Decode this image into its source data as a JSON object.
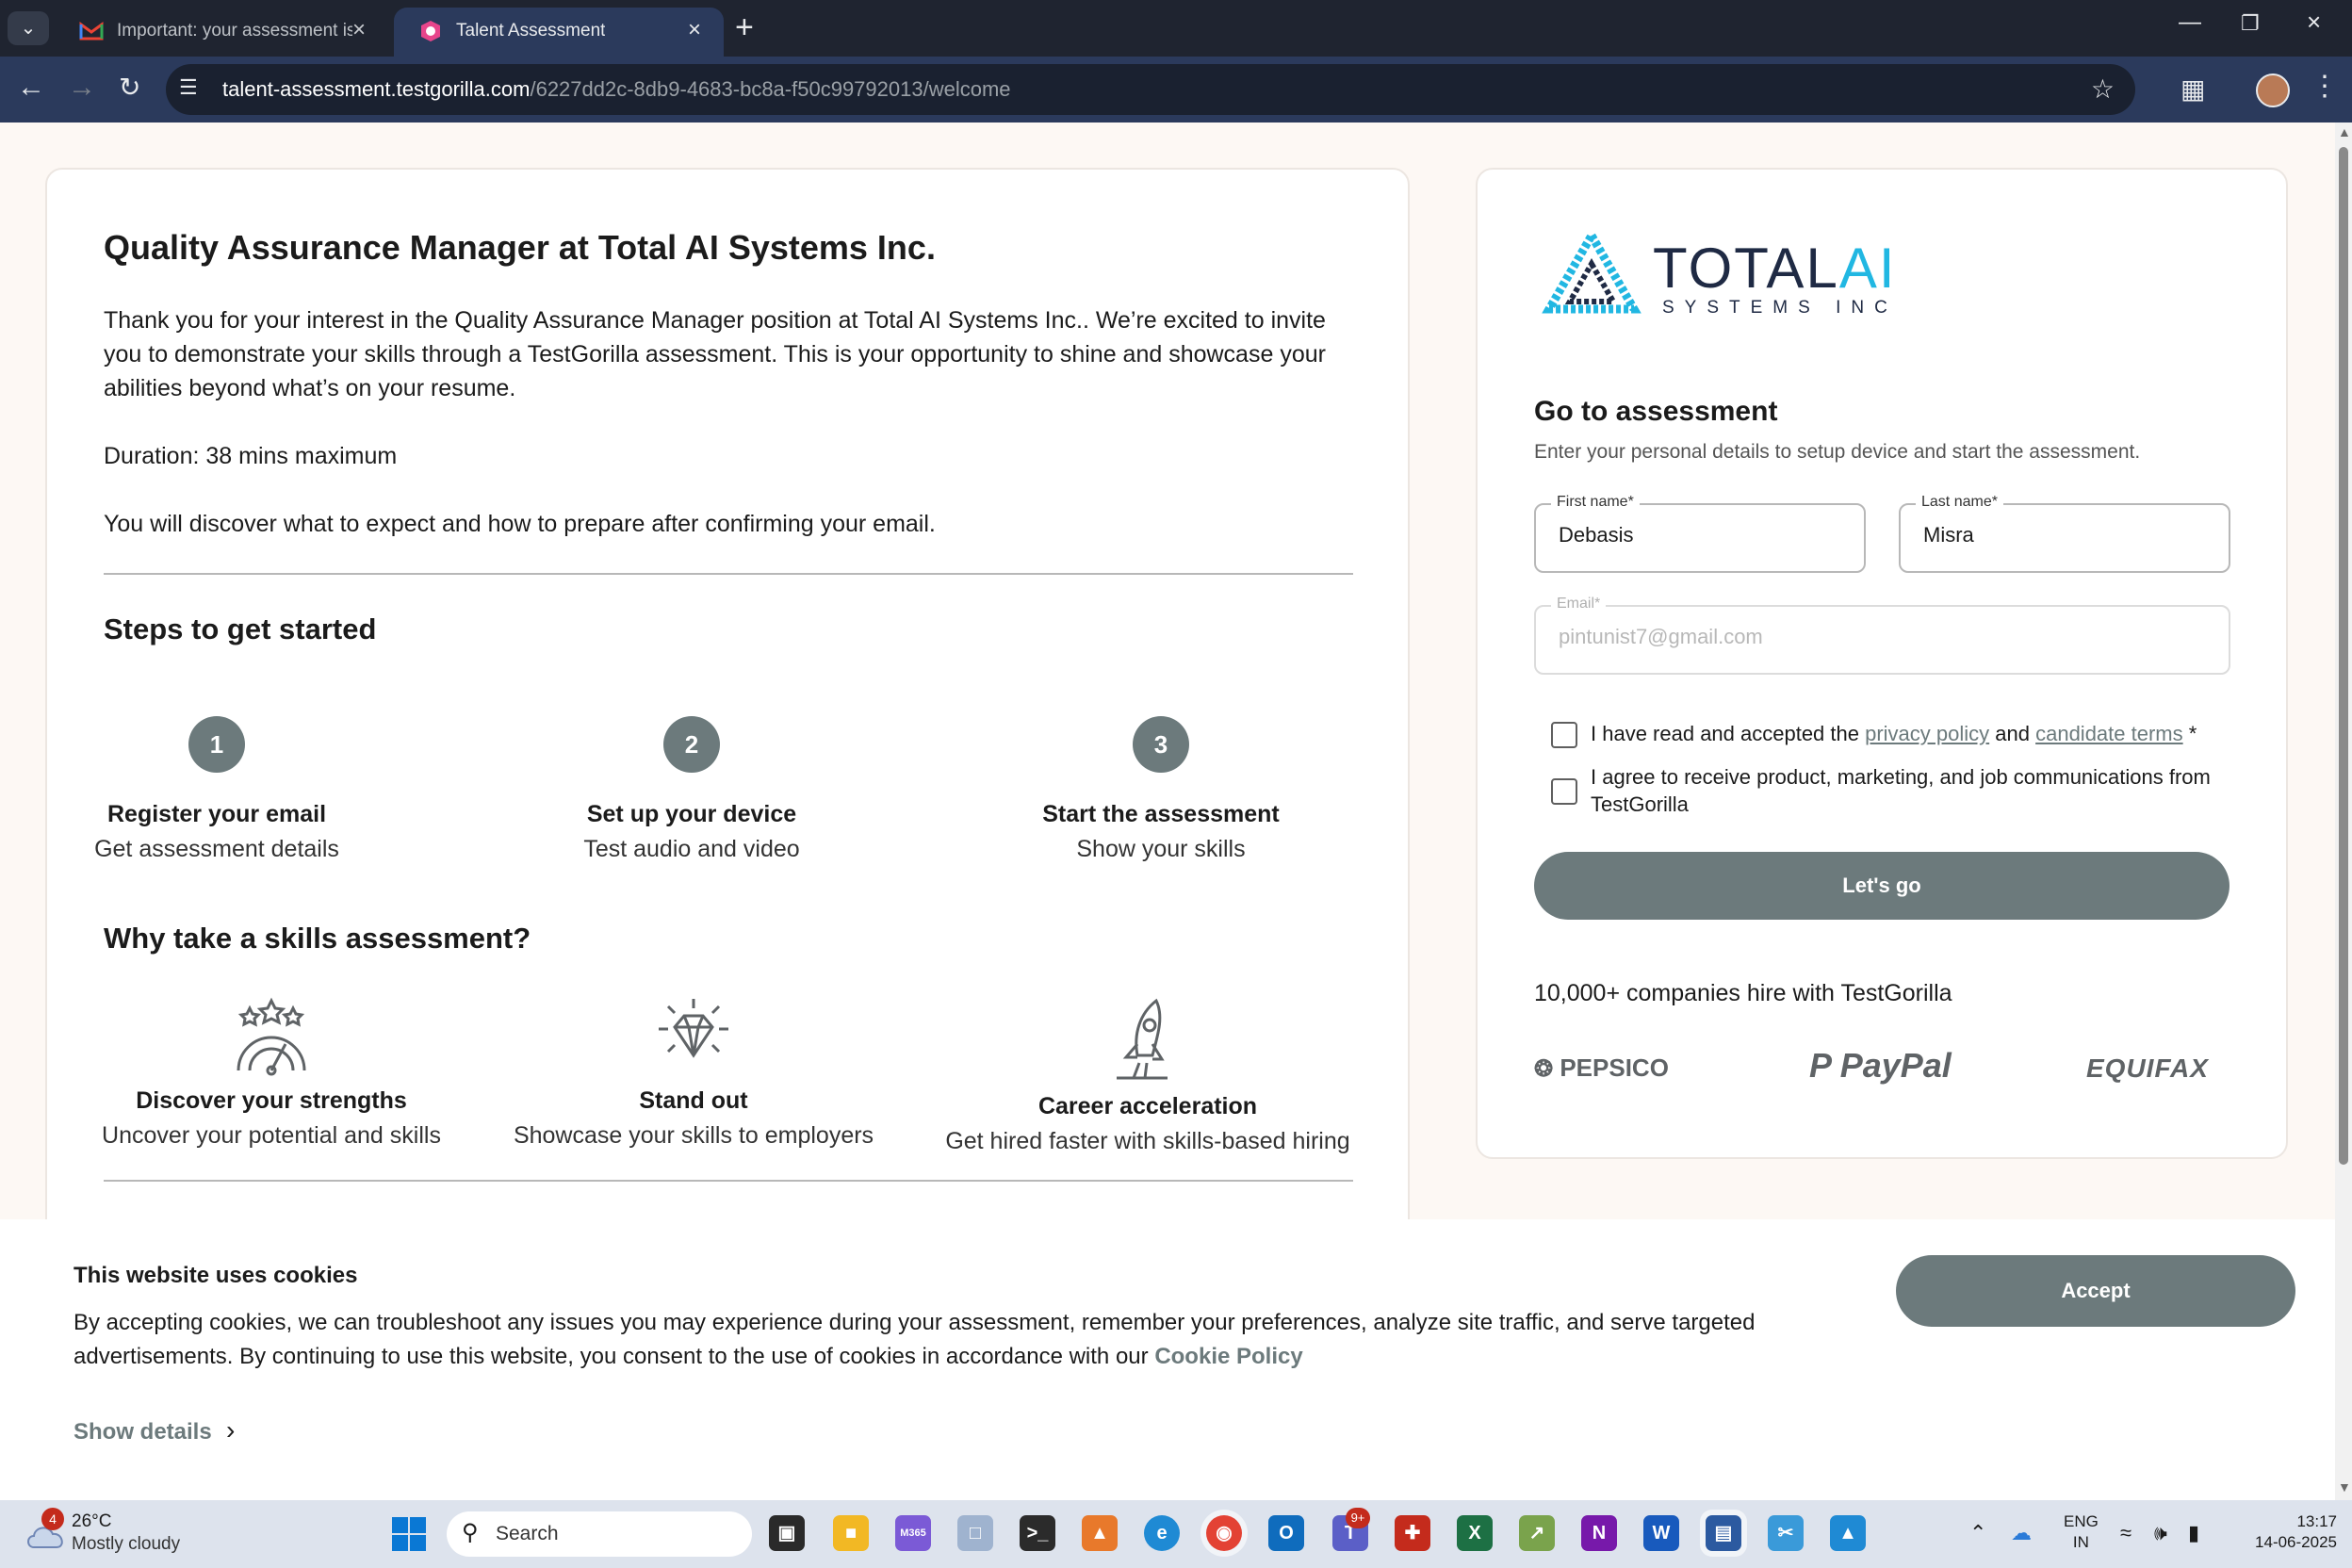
{
  "browser": {
    "tabs": [
      {
        "title": "Important: your assessment is w",
        "icon": "gmail-icon",
        "active": false
      },
      {
        "title": "Talent Assessment",
        "icon": "testgorilla-icon",
        "active": true
      }
    ],
    "url_host": "talent-assessment.testgorilla.com",
    "url_path": "/6227dd2c-8db9-4683-bc8a-f50c99792013/welcome"
  },
  "job": {
    "title": "Quality Assurance Manager at Total AI Systems Inc.",
    "intro": "Thank you for your interest in the Quality Assurance Manager position at Total AI Systems Inc.. We’re excited to invite you to demonstrate your skills through a TestGorilla assessment. This is your opportunity to shine and showcase your abilities beyond what’s on your resume.",
    "duration": "Duration: 38 mins maximum",
    "discover": "You will discover what to expect and how to prepare after confirming your email."
  },
  "steps": {
    "heading": "Steps to get started",
    "items": [
      {
        "num": "1",
        "title": "Register your email",
        "desc": "Get assessment details"
      },
      {
        "num": "2",
        "title": "Set up your device",
        "desc": "Test audio and video"
      },
      {
        "num": "3",
        "title": "Start the assessment",
        "desc": "Show your skills"
      }
    ]
  },
  "why": {
    "heading": "Why take a skills assessment?",
    "items": [
      {
        "icon": "strengths-gauge-icon",
        "title": "Discover your strengths",
        "desc": "Uncover your potential and skills"
      },
      {
        "icon": "diamond-icon",
        "title": "Stand out",
        "desc": "Showcase your skills to employers"
      },
      {
        "icon": "rocket-icon",
        "title": "Career acceleration",
        "desc": "Get hired faster with skills-based hiring"
      }
    ]
  },
  "company": {
    "logo_main": "TOTAL",
    "logo_ai": "AI",
    "logo_sub": "SYSTEMS INC"
  },
  "form": {
    "heading": "Go to assessment",
    "subheading": "Enter your personal details to setup device and start the assessment.",
    "first_name_label": "First name*",
    "first_name_value": "Debasis",
    "last_name_label": "Last name*",
    "last_name_value": "Misra",
    "email_label": "Email*",
    "email_value": "pintunist7@gmail.com",
    "consent_prefix": "I have read and accepted the ",
    "privacy_link": "privacy policy",
    "consent_and": " and ",
    "terms_link": "candidate terms",
    "consent_suffix": " *",
    "marketing": "I agree to receive product, marketing, and job communications from TestGorilla",
    "submit": "Let's go"
  },
  "hiring": {
    "text": "10,000+ companies hire with TestGorilla",
    "brands": [
      "PEPSICO",
      "PayPal",
      "EQUIFAX"
    ]
  },
  "cookie": {
    "title": "This website uses cookies",
    "body": "By accepting cookies, we can troubleshoot any issues you may experience during your assessment, remember your preferences, analyze site traffic, and serve targeted advertisements. By continuing to use this website, you consent to the use of cookies in accordance with our ",
    "policy_link": "Cookie Policy",
    "details": "Show details",
    "accept": "Accept"
  },
  "taskbar": {
    "weather_badge": "4",
    "temp": "26°C",
    "condition": "Mostly cloudy",
    "search_placeholder": "Search",
    "teams_badge": "9+",
    "lang_top": "ENG",
    "lang_bottom": "IN",
    "time": "13:17",
    "date": "14-06-2025"
  },
  "colors": {
    "accent": "#6c7a7c",
    "logo_blue": "#21b7e2",
    "browser_dark": "#1f2430"
  }
}
